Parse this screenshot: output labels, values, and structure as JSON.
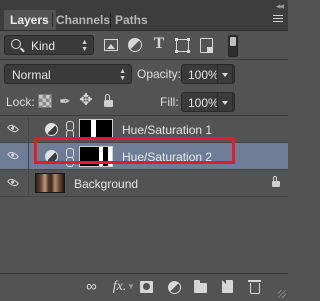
{
  "tabs": [
    {
      "label": "Layers",
      "active": true
    },
    {
      "label": "Channels",
      "active": false
    },
    {
      "label": "Paths",
      "active": false
    }
  ],
  "filter": {
    "kind_label": "Kind"
  },
  "blend": {
    "mode": "Normal",
    "opacity_label": "Opacity:",
    "opacity_value": "100%"
  },
  "lock": {
    "label": "Lock:",
    "fill_label": "Fill:",
    "fill_value": "100%"
  },
  "layers": [
    {
      "name": "Hue/Saturation 1",
      "type": "adjustment",
      "visible": true,
      "selected": false
    },
    {
      "name": "Hue/Saturation 2",
      "type": "adjustment",
      "visible": true,
      "selected": true
    },
    {
      "name": "Background",
      "type": "image",
      "visible": true,
      "selected": false,
      "locked": true
    }
  ],
  "colors": {
    "panel": "#535353",
    "tabbar": "#3d3d3d",
    "selected_row": "#6e7d95",
    "highlight": "#e31b23"
  },
  "icons": [
    "link-layers-icon",
    "fx-icon",
    "add-mask-icon",
    "adjustment-layer-icon",
    "new-group-icon",
    "new-layer-icon",
    "delete-icon"
  ]
}
